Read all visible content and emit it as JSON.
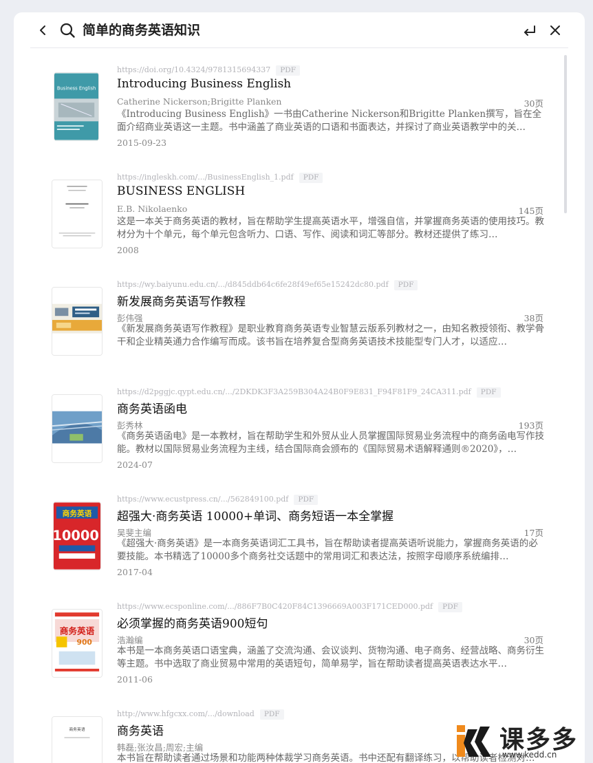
{
  "search": {
    "query": "简单的商务英语知识"
  },
  "results": [
    {
      "url": "https://doi.org/10.4324/9781315694337",
      "format": "PDF",
      "title": "Introducing Business English",
      "author": "Catherine Nickerson;Brigitte Planken",
      "pages": "30页",
      "description": "《Introducing Business English》一书由Catherine Nickerson和Brigitte Planken撰写，旨在全面介绍商业英语这一主题。书中涵盖了商业英语的口语和书面表达，并探讨了商业英语教学中的关…",
      "date": "2015-09-23",
      "cover_title": "Business English"
    },
    {
      "url": "https://ingleskh.com/.../BusinessEnglish_1.pdf",
      "format": "PDF",
      "title": "BUSINESS ENGLISH",
      "author": "E.B. Nikolaenko",
      "pages": "145页",
      "description": "这是一本关于商务英语的教材，旨在帮助学生提高英语水平，增强自信，并掌握商务英语的使用技巧。教材分为十个单元，每个单元包含听力、口语、写作、阅读和词汇等部分。教材还提供了练习…",
      "date": "2008"
    },
    {
      "url": "https://wy.baiyunu.edu.cn/.../d845ddb64c6fe28f49ef65e15242dc80.pdf",
      "format": "PDF",
      "title": "新发展商务英语写作教程",
      "author": "彭伟强",
      "pages": "38页",
      "description": "《新发展商务英语写作教程》是职业教育商务英语专业智慧云版系列教材之一，由知名教授领衔、教学骨干和企业精英通力合作编写而成。该书旨在培养复合型商务英语技术技能型专门人才，以适应…",
      "date": ""
    },
    {
      "url": "https://d2pggjc.qypt.edu.cn/.../2DKDK3F3A259B304A24B0F9E831_F94F81F9_24CA311.pdf",
      "format": "PDF",
      "title": "商务英语函电",
      "author": "彭秀林",
      "pages": "193页",
      "description": "《商务英语函电》是一本教材，旨在帮助学生和外贸从业人员掌握国际贸易业务流程中的商务函电写作技能。教材以国际贸易业务流程为主线，结合国际商会颁布的《国际贸易术语解释通则®2020》，…",
      "date": "2024-07"
    },
    {
      "url": "https://www.ecustpress.cn/.../562849100.pdf",
      "format": "PDF",
      "title": "超强大·商务英语 10000+单词、商务短语一本全掌握",
      "author": "吴斐主编",
      "pages": "17页",
      "description": "《超强大·商务英语》是一本商务英语词汇工具书，旨在帮助读者提高英语听说能力，掌握商务英语的必要技能。本书精选了10000多个商务社交话题中的常用词汇和表达法，按照字母顺序系统编排…",
      "date": "2017-04",
      "cover_title": "商务英语",
      "cover_number": "10000"
    },
    {
      "url": "https://www.ecsponline.com/.../886F7B0C420F84C1396669A003F171CED000.pdf",
      "format": "PDF",
      "title": "必须掌握的商务英语900短句",
      "author": "浩瀚编",
      "pages": "30页",
      "description": "本书是一本商务英语口语宝典，涵盖了交流沟通、会议谈判、货物沟通、电子商务、经营战略、商务衍生等主题。书中选取了商业贸易中常用的英语短句，简单易学，旨在帮助读者提高英语表达水平…",
      "date": "2011-06",
      "cover_title": "商务英语",
      "cover_number": "900"
    },
    {
      "url": "http://www.hfgcxx.com/.../download",
      "format": "PDF",
      "title": "商务英语",
      "author": "韩磊;张汝昌;周宏;主编",
      "pages": "",
      "description": "本书旨在帮助读者通过场景和功能两种体裁学习商务英语。书中还配有翻译练习，以帮助读者检测对…",
      "date": "",
      "cover_title": "商务英语"
    }
  ],
  "watermark": {
    "name": "课多多",
    "url": "www.kedd.cn"
  }
}
